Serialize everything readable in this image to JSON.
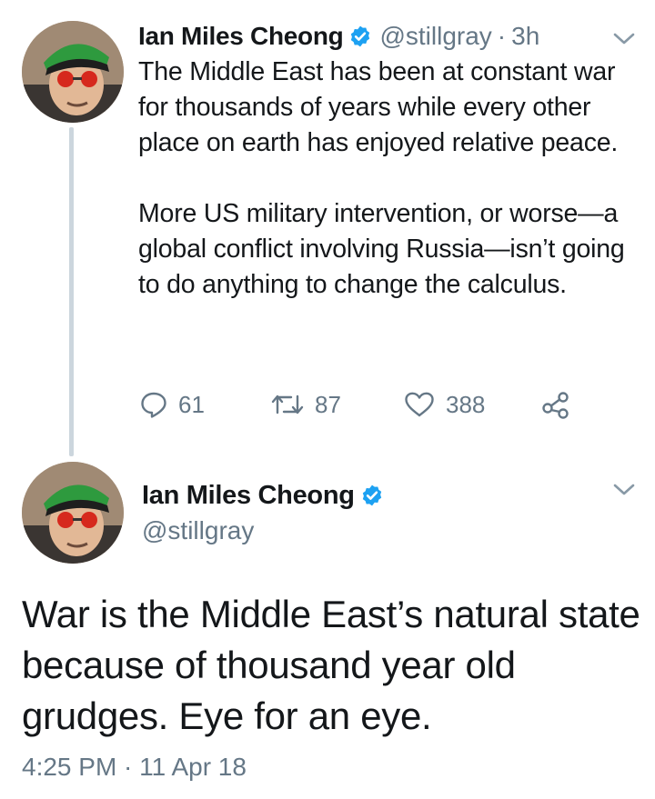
{
  "tweet1": {
    "author_name": "Ian Miles Cheong",
    "handle": "@stillgray",
    "separator": "·",
    "age": "3h",
    "paragraphs": [
      "The Middle East has been at constant war for thousands of years while every other place on earth has enjoyed relative peace.",
      "More US military intervention, or worse—a global conflict involving Russia—isn’t going to do anything to change the calculus."
    ],
    "replies": "61",
    "retweets": "87",
    "likes": "388"
  },
  "tweet2": {
    "author_name": "Ian Miles Cheong",
    "handle": "@stillgray",
    "text": "War is the Middle East’s natural state because of thousand year old grudges. Eye for an eye.",
    "timestamp": "4:25 PM · 11 Apr 18"
  },
  "icons": {
    "verified": "verified-badge-icon",
    "more": "chevron-down-icon",
    "reply": "reply-icon",
    "retweet": "retweet-icon",
    "like": "heart-icon",
    "share": "share-icon"
  },
  "colors": {
    "text": "#14171a",
    "secondary": "#657786",
    "verified": "#1da1f2",
    "thread_line": "#ccd6dd"
  }
}
